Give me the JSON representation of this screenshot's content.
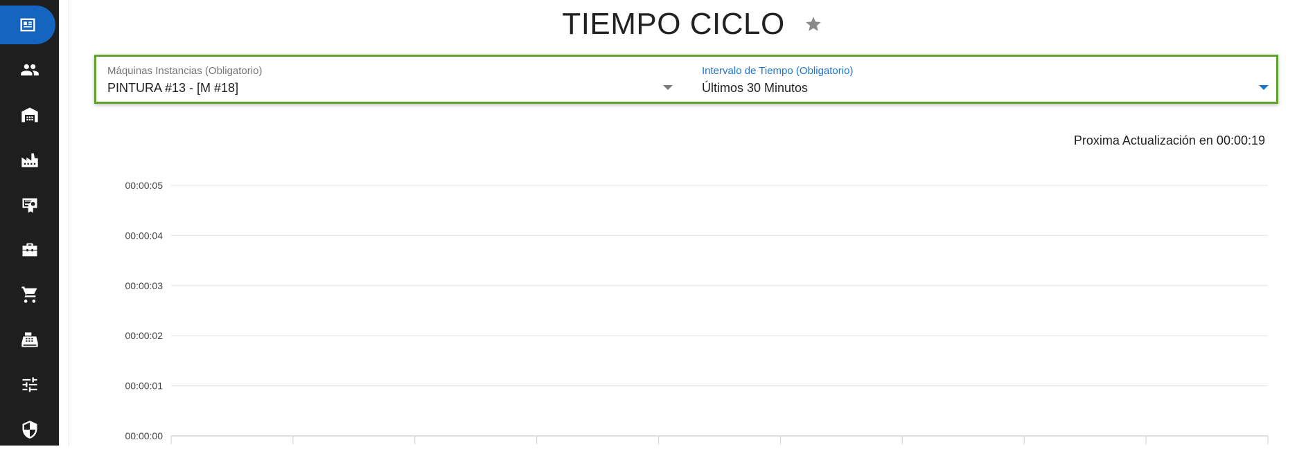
{
  "sidebar": {
    "items": [
      {
        "icon": "dashboard-icon",
        "active": true
      },
      {
        "icon": "people-icon",
        "active": false
      },
      {
        "icon": "warehouse-icon",
        "active": false
      },
      {
        "icon": "factory-icon",
        "active": false
      },
      {
        "icon": "certificate-icon",
        "active": false
      },
      {
        "icon": "toolbox-icon",
        "active": false
      },
      {
        "icon": "cart-icon",
        "active": false
      },
      {
        "icon": "cash-register-icon",
        "active": false
      },
      {
        "icon": "sliders-icon",
        "active": false
      },
      {
        "icon": "shield-icon",
        "active": false
      }
    ]
  },
  "header": {
    "title": "TIEMPO CICLO",
    "favorite_icon": "star-icon"
  },
  "filters": {
    "machine": {
      "label": "Máquinas Instancias (Obligatorio)",
      "value": "PINTURA #13 - [M #18]"
    },
    "interval": {
      "label": "Intervalo de Tiempo (Obligatorio)",
      "value": "Últimos 30 Minutos"
    },
    "border_color": "#5fa12a",
    "accent_color": "#1976d2"
  },
  "status": {
    "next_update": "Proxima Actualización en 00:00:19"
  },
  "chart_data": {
    "type": "line",
    "y_tick_labels": [
      "00:00:05",
      "00:00:04",
      "00:00:03",
      "00:00:02",
      "00:00:01",
      "00:00:00"
    ],
    "ylim": [
      0,
      5
    ],
    "x_divisions": 9,
    "series": [],
    "grid": true
  }
}
